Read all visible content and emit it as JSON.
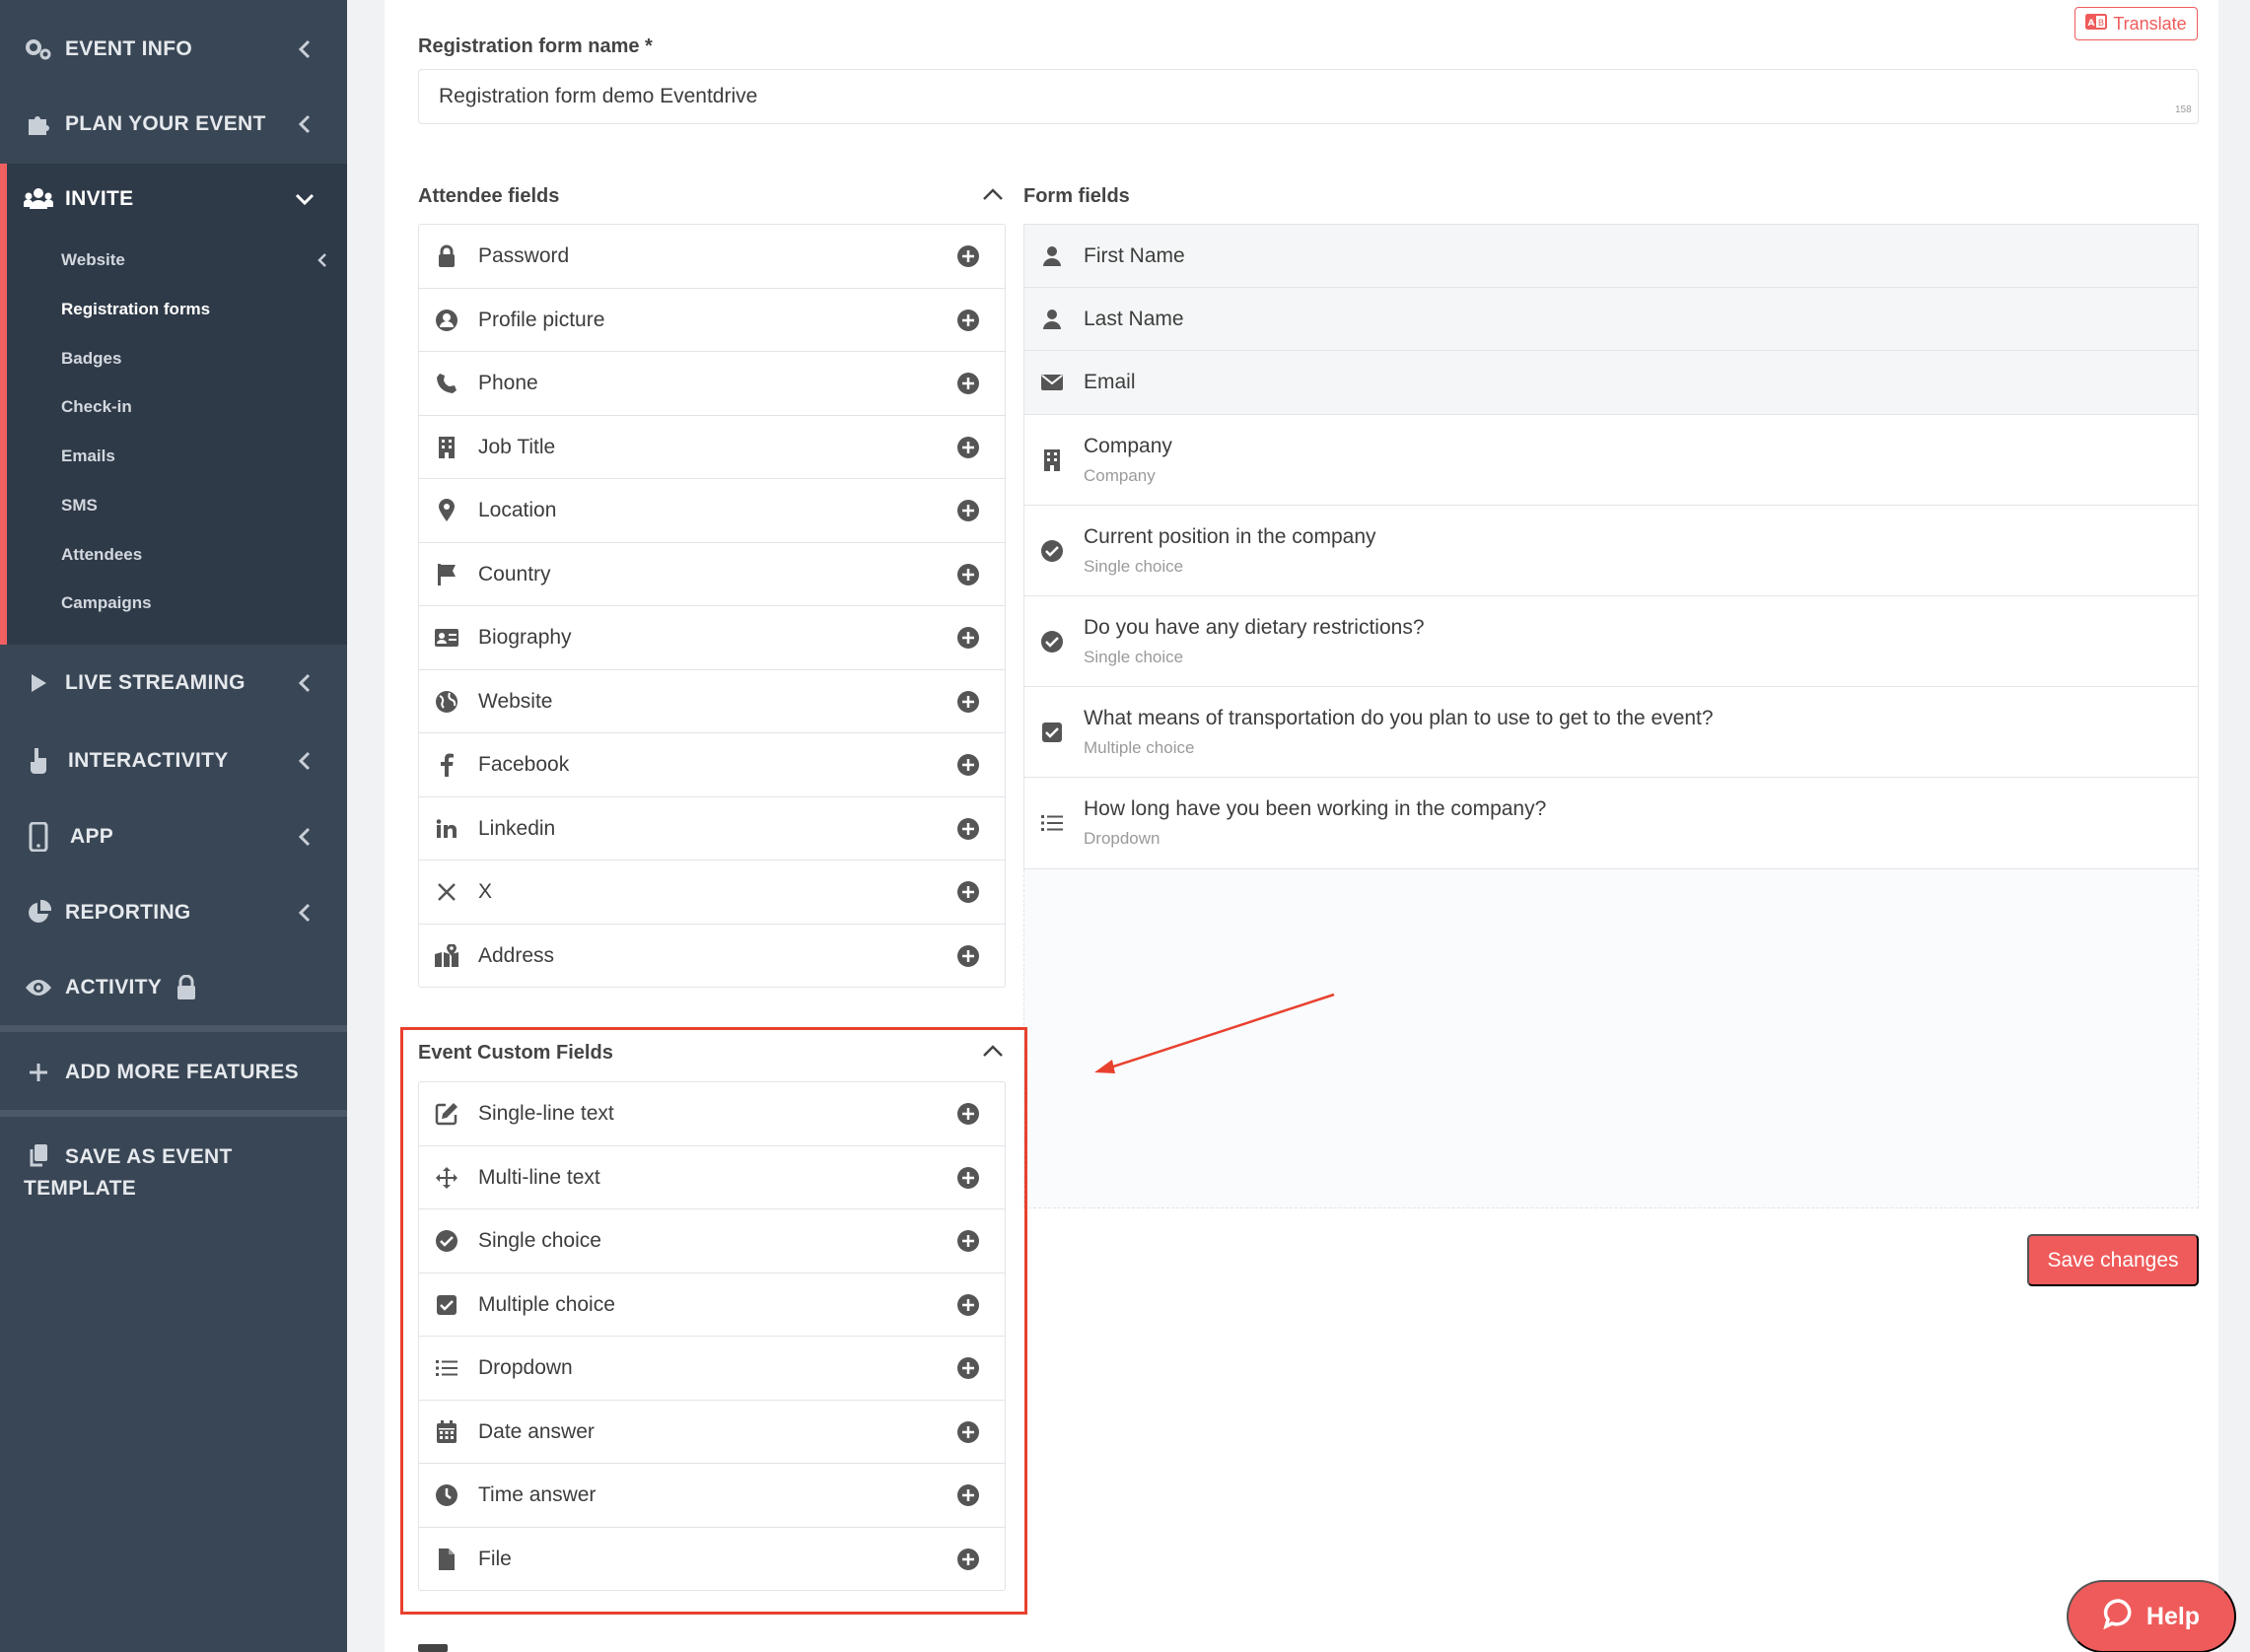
{
  "sidebar": {
    "items": [
      {
        "label": "EVENT INFO",
        "icon": "gears-icon"
      },
      {
        "label": "PLAN YOUR EVENT",
        "icon": "puzzle-icon"
      },
      {
        "label": "INVITE",
        "icon": "users-icon"
      },
      {
        "label": "LIVE STREAMING",
        "icon": "play-icon"
      },
      {
        "label": "INTERACTIVITY",
        "icon": "hand-pointer-icon"
      },
      {
        "label": "APP",
        "icon": "mobile-icon"
      },
      {
        "label": "REPORTING",
        "icon": "pie-chart-icon"
      },
      {
        "label": "ACTIVITY",
        "icon": "eye-icon"
      },
      {
        "label": "ADD MORE FEATURES",
        "icon": "plus-icon"
      },
      {
        "label": "SAVE AS EVENT TEMPLATE",
        "icon": "copy-icon"
      }
    ],
    "invite_sub": [
      "Website",
      "Registration forms",
      "Badges",
      "Check-in",
      "Emails",
      "SMS",
      "Attendees",
      "Campaigns"
    ]
  },
  "form": {
    "translate": "Translate",
    "name_label": "Registration form name *",
    "name_value": "Registration form demo Eventdrive",
    "char_count": "158",
    "attendee_header": "Attendee fields",
    "form_header": "Form fields",
    "custom_header": "Event Custom Fields",
    "save": "Save changes",
    "help": "Help"
  },
  "attendee_fields": [
    "Password",
    "Profile picture",
    "Phone",
    "Job Title",
    "Location",
    "Country",
    "Biography",
    "Website",
    "Facebook",
    "Linkedin",
    "X",
    "Address"
  ],
  "custom_fields": [
    "Single-line text",
    "Multi-line text",
    "Single choice",
    "Multiple choice",
    "Dropdown",
    "Date answer",
    "Time answer",
    "File"
  ],
  "form_fields": [
    {
      "title": "First Name",
      "sub": ""
    },
    {
      "title": "Last Name",
      "sub": ""
    },
    {
      "title": "Email",
      "sub": ""
    },
    {
      "title": "Company",
      "sub": "Company"
    },
    {
      "title": "Current position in the company",
      "sub": "Single choice"
    },
    {
      "title": "Do you have any dietary restrictions?",
      "sub": "Single choice"
    },
    {
      "title": "What means of transportation do you plan to use to get to the event?",
      "sub": "Multiple choice"
    },
    {
      "title": "How long have you been working in the company?",
      "sub": "Dropdown"
    }
  ],
  "colors": {
    "accent": "#ef5b5b",
    "sidebar": "#394655",
    "highlight": "#e8412e"
  }
}
